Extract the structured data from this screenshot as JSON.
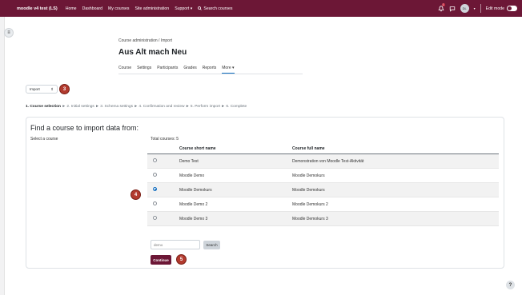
{
  "navbar": {
    "brand": "moodle v4 test (LS)",
    "links": [
      "Home",
      "Dashboard",
      "My courses",
      "Site administration",
      "Support ▾"
    ],
    "search_label": "Search courses",
    "notification_count": "1",
    "avatar_initials": "DL",
    "edit_mode_label": "Edit mode",
    "brand_color": "#6c1736"
  },
  "header": {
    "breadcrumb": "Course administration / Import",
    "title": "Aus Alt mach Neu",
    "tabs": [
      "Course",
      "Settings",
      "Participants",
      "Grades",
      "Reports",
      "More ▾"
    ]
  },
  "import_select": {
    "value": "Import"
  },
  "badges": {
    "b3": "3",
    "b4": "4",
    "b5": "5"
  },
  "steps": {
    "current": "1. Course selection",
    "rest": " ► 2. Initial settings ► 3. Schema settings ► 4. Confirmation and review ► 5. Perform import ► 6. Complete"
  },
  "card": {
    "title": "Find a course to import data from:",
    "select_label": "Select a course",
    "total": "Total courses: 5",
    "columns": [
      "Course short name",
      "Course full name"
    ],
    "rows": [
      {
        "short": "Demo Test",
        "full": "Demonstration von Moodle Test-Aktivität",
        "checked": false
      },
      {
        "short": "Moodle Demo",
        "full": "Moodle Demokurs",
        "checked": false
      },
      {
        "short": "Moodle Demokurs",
        "full": "Moodle Demokurs",
        "checked": true
      },
      {
        "short": "Moodle Demo 2",
        "full": "Moodle Demokurs 2",
        "checked": false
      },
      {
        "short": "Moodle Demo 3",
        "full": "Moodle Demokurs 3",
        "checked": false
      }
    ],
    "search_value": "demo",
    "search_button": "Search",
    "continue_button": "Continue"
  },
  "help_label": "?"
}
